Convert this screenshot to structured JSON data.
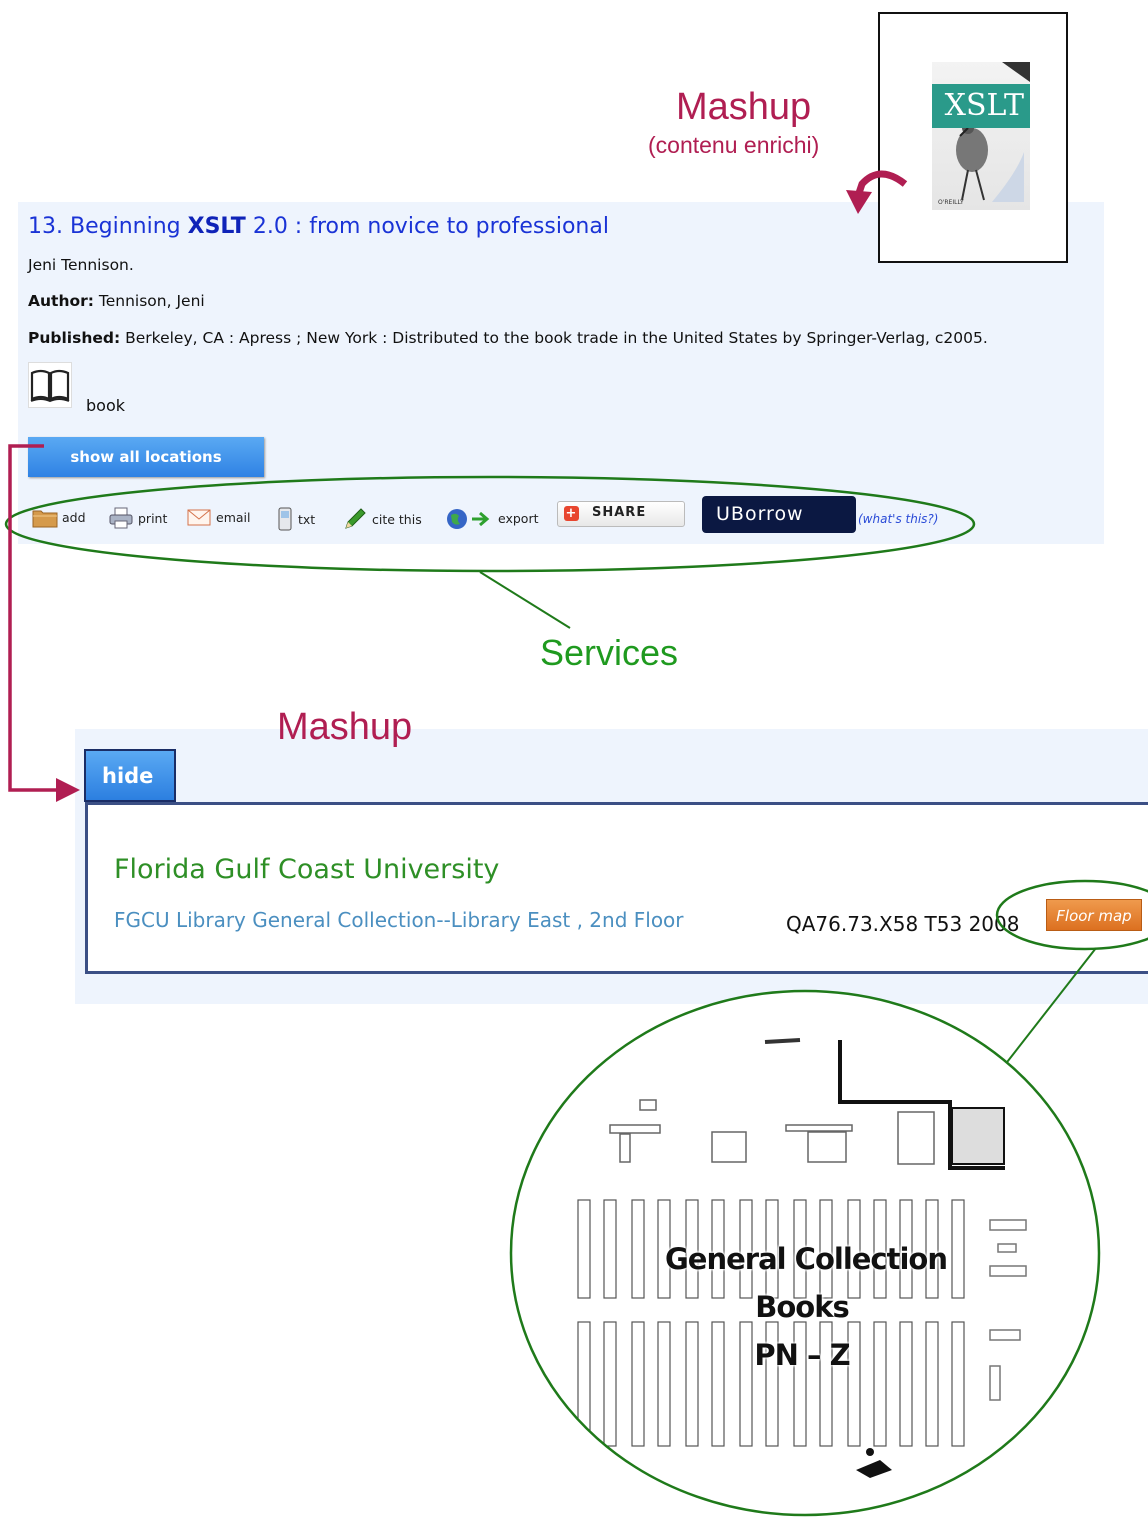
{
  "annotations": {
    "mashup_top": "Mashup",
    "mashup_top_sub": "(contenu enrichi)",
    "services": "Services",
    "mashup_bottom": "Mashup"
  },
  "cover": {
    "title_text": "XSLT"
  },
  "record": {
    "number": "13.",
    "title_pre": "Beginning",
    "title_bold": "XSLT",
    "title_post": "2.0 : from novice to professional",
    "statement": "Jeni Tennison.",
    "author_label": "Author:",
    "author_value": "Tennison, Jeni",
    "published_label": "Published:",
    "published_value": "Berkeley, CA : Apress ; New York : Distributed to the book trade in the United States by Springer-Verlag, c2005.",
    "format_label": "book",
    "show_locations_label": "show all locations"
  },
  "services": {
    "add": "add",
    "print": "print",
    "email": "email",
    "txt": "txt",
    "cite": "cite this",
    "export": "export",
    "share": "SHARE",
    "uborrow": "UBorrow",
    "whats_this": "(what's this?)"
  },
  "location": {
    "hide_label": "hide",
    "university": "Florida Gulf Coast University",
    "collection": "FGCU Library General Collection--Library East , 2nd Floor",
    "call_number": "QA76.73.X58 T53 2008",
    "floor_map_label": "Floor map"
  },
  "floor_map": {
    "line1": "General Collection",
    "line2": "Books",
    "line3": "PN – Z"
  },
  "colors": {
    "annotation_red": "#b01e52",
    "annotation_green": "#1f9a1f",
    "link_blue": "#1a33d6",
    "panel_bg": "#eef4fd",
    "button_blue": "#3a8ae8",
    "floor_map_orange": "#e27a28"
  }
}
